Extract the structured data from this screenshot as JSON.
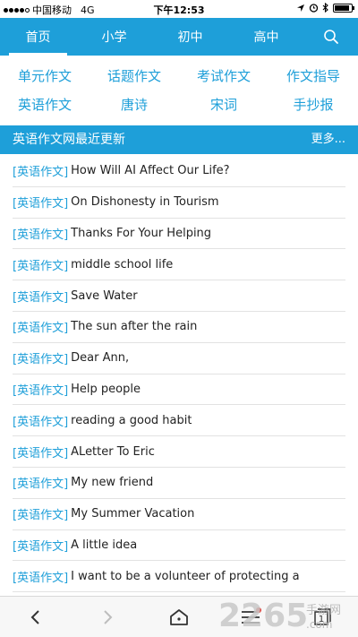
{
  "status": {
    "carrier": "中国移动",
    "network": "4G",
    "time": "下午12:53",
    "battery_level": 0.9
  },
  "nav": {
    "tabs": [
      {
        "label": "首页",
        "active": true
      },
      {
        "label": "小学",
        "active": false
      },
      {
        "label": "初中",
        "active": false
      },
      {
        "label": "高中",
        "active": false
      }
    ],
    "search_icon": "search-icon"
  },
  "categories": {
    "row1": [
      "单元作文",
      "话题作文",
      "考试作文",
      "作文指导"
    ],
    "row2": [
      "英语作文",
      "唐诗",
      "宋词",
      "手抄报"
    ]
  },
  "section": {
    "title": "英语作文网最近更新",
    "more": "更多..."
  },
  "articles": [
    {
      "tag": "[英语作文]",
      "title": "How Will AI Affect Our Life?"
    },
    {
      "tag": "[英语作文]",
      "title": "On Dishonesty in Tourism"
    },
    {
      "tag": "[英语作文]",
      "title": "Thanks For Your Helping"
    },
    {
      "tag": "[英语作文]",
      "title": "middle school life"
    },
    {
      "tag": "[英语作文]",
      "title": "Save Water"
    },
    {
      "tag": "[英语作文]",
      "title": "The sun after the rain"
    },
    {
      "tag": "[英语作文]",
      "title": "Dear Ann,"
    },
    {
      "tag": "[英语作文]",
      "title": "Help people"
    },
    {
      "tag": "[英语作文]",
      "title": "reading a good habit"
    },
    {
      "tag": "[英语作文]",
      "title": "ALetter To Eric"
    },
    {
      "tag": "[英语作文]",
      "title": "My new friend"
    },
    {
      "tag": "[英语作文]",
      "title": "My Summer Vacation"
    },
    {
      "tag": "[英语作文]",
      "title": "A little idea"
    },
    {
      "tag": "[英语作文]",
      "title": "I want to be a volunteer of protecting a"
    }
  ],
  "toolbar": {
    "tab_count": "1"
  },
  "watermark": {
    "text": "2265",
    "sub": ".com",
    "cn": "手游网"
  },
  "colors": {
    "accent": "#1e9fd9",
    "divider": "#e2e2e2",
    "text": "#222222"
  }
}
